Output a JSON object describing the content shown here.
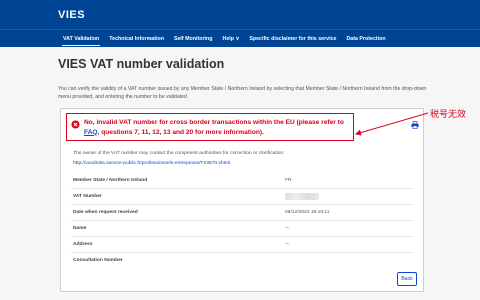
{
  "header": {
    "brand": "VIES"
  },
  "nav": {
    "items": [
      {
        "label": "VAT Validation",
        "active": true
      },
      {
        "label": "Technical Information",
        "active": false
      },
      {
        "label": "Self Monitoring",
        "active": false
      },
      {
        "label": "Help ∨",
        "active": false
      },
      {
        "label": "Specific disclaimer for this service",
        "active": false
      },
      {
        "label": "Data Protection",
        "active": false
      }
    ]
  },
  "page": {
    "title": "VIES VAT number validation",
    "intro": "You can verify the validity of a VAT number issued by any Member State / Northern Ireland by selecting that Member State / Northern Ireland from the drop-down menu provided, and entering the number to be validated"
  },
  "result": {
    "error_before": "No, invalid VAT number for cross border transactions within the EU (please refer to ",
    "error_link": "FAQ",
    "error_after": ", questions 7, 11, 12, 13 and 20 for more information).",
    "contact_note": "The owner of the VAT number may contact the competent authorities for correction or clarification:",
    "contact_link": "http://vosdroits.service-public.fr/professionnels-entreprises/F23570.xhtml",
    "details": [
      {
        "label": "Member State / Northern Ireland",
        "value": "FR"
      },
      {
        "label": "VAT Number",
        "value": ""
      },
      {
        "label": "Date when request received",
        "value": "06/12/2022 19:18:11"
      },
      {
        "label": "Name",
        "value": "---"
      },
      {
        "label": "Address",
        "value": "---"
      },
      {
        "label": "Consultation Number",
        "value": ""
      }
    ],
    "back_label": "Back"
  },
  "annotation": {
    "label": "税号无效",
    "color": "#e0001a"
  },
  "colors": {
    "header_bg": "#004494",
    "error": "#d5001a",
    "link": "#0e47cb"
  },
  "icons": {
    "error": "error-circle-icon",
    "print": "print-icon"
  }
}
